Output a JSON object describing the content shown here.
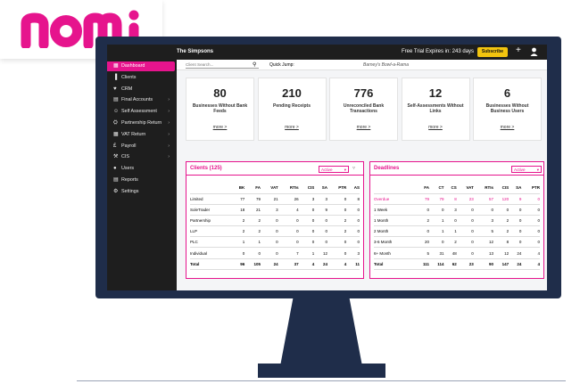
{
  "brand": {
    "name": "nomi",
    "color": "#e6148d"
  },
  "header": {
    "title": "The Simpsons",
    "trial_text": "Free Trial Expires in: 243 days",
    "subscribe_label": "Subscribe",
    "plus_label": "+"
  },
  "search": {
    "placeholder": "Client Search...",
    "quick_jump": "Quick Jump:",
    "selected_client": "Barney's Bowl-a-Rama"
  },
  "sidebar": {
    "items": [
      {
        "label": "Dashboard",
        "icon": "dashboard-icon",
        "active": true
      },
      {
        "label": "Clients",
        "icon": "chart-icon"
      },
      {
        "label": "CRM",
        "icon": "handshake-icon"
      },
      {
        "label": "Final Accounts",
        "icon": "document-icon",
        "chevron": true
      },
      {
        "label": "Self Assessment",
        "icon": "person-icon",
        "chevron": true
      },
      {
        "label": "Partnership Return",
        "icon": "partnership-icon",
        "chevron": true
      },
      {
        "label": "VAT Return",
        "icon": "calculator-icon",
        "chevron": true
      },
      {
        "label": "Payroll",
        "icon": "money-icon",
        "chevron": true
      },
      {
        "label": "CIS",
        "icon": "tools-icon",
        "chevron": true
      },
      {
        "label": "Users",
        "icon": "user-icon"
      },
      {
        "label": "Reports",
        "icon": "report-icon"
      },
      {
        "label": "Settings",
        "icon": "gear-icon"
      }
    ]
  },
  "cards": [
    {
      "value": "80",
      "label": "Businesses Without Bank Feeds",
      "link": "more >"
    },
    {
      "value": "210",
      "label": "Pending Receipts",
      "link": "more >"
    },
    {
      "value": "776",
      "label": "Unreconciled Bank Transactions",
      "link": "more >"
    },
    {
      "value": "12",
      "label": "Self-Assessments Without Links",
      "link": "more >"
    },
    {
      "value": "6",
      "label": "Businesses Without Business Users",
      "link": "more >"
    }
  ],
  "clients_panel": {
    "title": "Clients (125)",
    "filter_value": "Active",
    "columns": [
      "",
      "BK",
      "FA",
      "VAT",
      "RTIs",
      "CIS",
      "SA",
      "PTR",
      "AS"
    ],
    "rows": [
      [
        "Limited",
        "77",
        "79",
        "21",
        "26",
        "3",
        "3",
        "0",
        "8"
      ],
      [
        "SoleTrader",
        "18",
        "21",
        "3",
        "4",
        "0",
        "9",
        "0",
        "0"
      ],
      [
        "Partnership",
        "2",
        "2",
        "0",
        "0",
        "0",
        "0",
        "2",
        "0"
      ],
      [
        "LLP",
        "2",
        "2",
        "0",
        "0",
        "0",
        "0",
        "2",
        "0"
      ],
      [
        "PLC",
        "1",
        "1",
        "0",
        "0",
        "0",
        "0",
        "0",
        "0"
      ],
      [
        "Individual",
        "0",
        "0",
        "0",
        "7",
        "1",
        "12",
        "0",
        "3"
      ],
      [
        "Total",
        "96",
        "105",
        "24",
        "37",
        "4",
        "24",
        "4",
        "11"
      ]
    ]
  },
  "deadlines_panel": {
    "title": "Deadlines",
    "filter_value": "Active",
    "columns": [
      "",
      "FA",
      "CT",
      "CS",
      "VAT",
      "RTIs",
      "CIS",
      "SA",
      "PTR"
    ],
    "rows": [
      [
        "Overdue",
        "79",
        "79",
        "8",
        "23",
        "57",
        "120",
        "9",
        "0"
      ],
      [
        "1 Week",
        "0",
        "0",
        "3",
        "0",
        "0",
        "0",
        "0",
        "0"
      ],
      [
        "1 Month",
        "2",
        "1",
        "0",
        "0",
        "3",
        "2",
        "0",
        "0"
      ],
      [
        "2 Month",
        "0",
        "1",
        "1",
        "0",
        "5",
        "2",
        "0",
        "0"
      ],
      [
        "3-6 Month",
        "20",
        "0",
        "2",
        "0",
        "12",
        "8",
        "0",
        "0"
      ],
      [
        "6+ Month",
        "5",
        "31",
        "48",
        "0",
        "13",
        "12",
        "24",
        "4"
      ],
      [
        "Total",
        "111",
        "114",
        "62",
        "23",
        "90",
        "147",
        "24",
        "4"
      ]
    ]
  }
}
